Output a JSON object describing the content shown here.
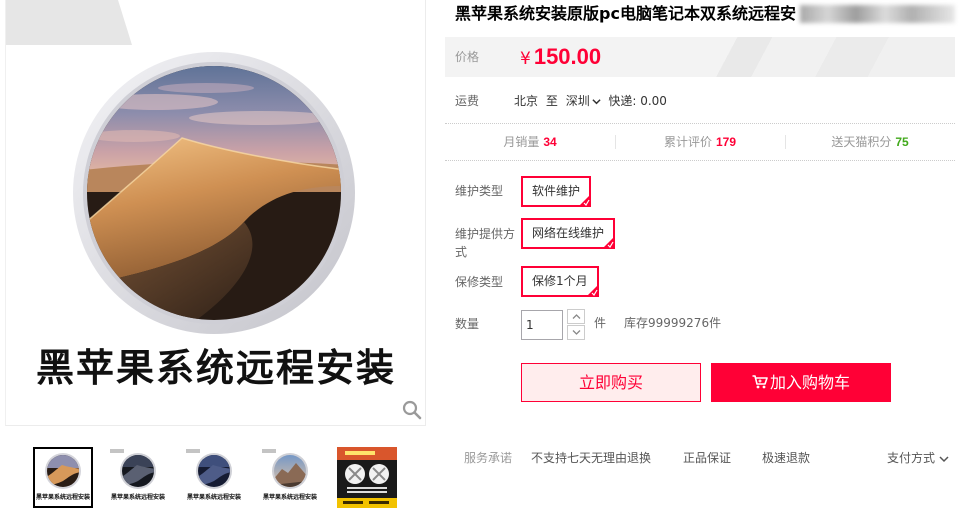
{
  "gallery": {
    "main_caption": "黑苹果系统远程安装",
    "zoom_icon": "magnifier-icon",
    "thumbnails": [
      {
        "caption": "黑苹果系统远程安装",
        "selected": true
      },
      {
        "caption": "黑苹果系统远程安装",
        "selected": false
      },
      {
        "caption": "黑苹果系统远程安装",
        "selected": false
      },
      {
        "caption": "黑苹果系统远程安装",
        "selected": false
      },
      {
        "selected": false
      }
    ]
  },
  "product": {
    "title": "黑苹果系统安装原版pc电脑笔记本双系统远程安",
    "price": {
      "label": "价格",
      "currency": "¥",
      "amount": "150.00"
    },
    "shipping": {
      "label": "运费",
      "from": "北京",
      "sep": "至",
      "to": "深圳",
      "method": "快递: 0.00"
    },
    "stats": [
      {
        "label": "月销量",
        "value": "34",
        "color": "#ff0036"
      },
      {
        "label": "累计评价",
        "value": "179",
        "color": "#ff0036"
      },
      {
        "label": "送天猫积分",
        "value": "75",
        "color": "#41a91b"
      }
    ],
    "options": [
      {
        "label": "维护类型",
        "value": "软件维护",
        "selected": true
      },
      {
        "label": "维护提供方式",
        "value": "网络在线维护",
        "selected": true
      },
      {
        "label": "保修类型",
        "value": "保修1个月",
        "selected": true
      }
    ],
    "quantity": {
      "label": "数量",
      "value": "1",
      "unit": "件",
      "stock": "库存99999276件"
    },
    "actions": {
      "buy_now": "立即购买",
      "add_to_cart": "加入购物车"
    },
    "services": {
      "label": "服务承诺",
      "items": [
        "不支持七天无理由退换",
        "正品保证",
        "极速退款"
      ],
      "payment": "支付方式"
    }
  },
  "colors": {
    "accent": "#ff0036",
    "accent_light": "#ffeded",
    "green": "#41a91b",
    "text": "#333333",
    "muted": "#999999"
  },
  "icons": [
    "magnifier-icon",
    "chevron-down-icon",
    "chevron-up-icon",
    "cart-icon",
    "check-corner-icon"
  ]
}
